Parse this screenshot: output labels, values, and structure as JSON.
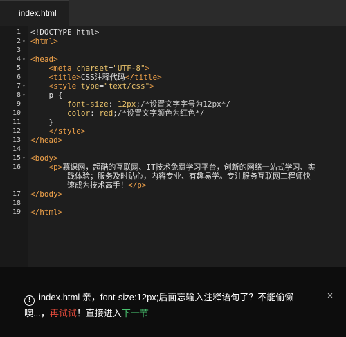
{
  "tab": {
    "filename": "index.html"
  },
  "code_lines": [
    {
      "n": "1",
      "fold": false,
      "html": "<span class=\"plain\">&lt;!DOCTYPE html&gt;</span>"
    },
    {
      "n": "2",
      "fold": true,
      "html": "<span class=\"tag\">&lt;html&gt;</span>"
    },
    {
      "n": "3",
      "fold": false,
      "html": ""
    },
    {
      "n": "4",
      "fold": true,
      "html": "<span class=\"tag\">&lt;head&gt;</span>"
    },
    {
      "n": "5",
      "fold": false,
      "html": "    <span class=\"tag\">&lt;meta</span> <span class=\"attr\">charset</span><span class=\"plain\">=</span><span class=\"str\">\"UTF-8\"</span><span class=\"tag\">&gt;</span>"
    },
    {
      "n": "6",
      "fold": false,
      "html": "    <span class=\"tag\">&lt;title&gt;</span><span class=\"plain\">CSS注释代码</span><span class=\"tag\">&lt;/title&gt;</span>"
    },
    {
      "n": "7",
      "fold": true,
      "html": "    <span class=\"tag\">&lt;style</span> <span class=\"attr\">type</span><span class=\"plain\">=</span><span class=\"str\">\"text/css\"</span><span class=\"tag\">&gt;</span>"
    },
    {
      "n": "8",
      "fold": true,
      "html": "    <span class=\"plain\">p {</span>"
    },
    {
      "n": "9",
      "fold": false,
      "html": "        <span class=\"prop\">font-size</span><span class=\"plain\">: </span><span class=\"num\">12px</span><span class=\"plain\">;</span><span class=\"cmt\">/*设置文字字号为12px*/</span>"
    },
    {
      "n": "10",
      "fold": false,
      "html": "        <span class=\"prop\">color</span><span class=\"plain\">: </span><span class=\"val\">red</span><span class=\"plain\">;</span><span class=\"cmt\">/*设置文字颜色为红色*/</span>"
    },
    {
      "n": "11",
      "fold": false,
      "html": "    <span class=\"plain\">}</span>"
    },
    {
      "n": "12",
      "fold": false,
      "html": "    <span class=\"tag\">&lt;/style&gt;</span>"
    },
    {
      "n": "13",
      "fold": false,
      "html": "<span class=\"tag\">&lt;/head&gt;</span>"
    },
    {
      "n": "14",
      "fold": false,
      "html": ""
    },
    {
      "n": "15",
      "fold": true,
      "html": "<span class=\"tag\">&lt;body&gt;</span>"
    },
    {
      "n": "16",
      "fold": false,
      "html": "    <span class=\"tag\">&lt;p&gt;</span><span class=\"plain\">慕课网，超酷的互联网、IT技术免费学习平台，创新的网络一站式学习、实</span>"
    },
    {
      "n": "",
      "fold": false,
      "html": "        <span class=\"plain\">践体验；服务及时贴心，内容专业、有趣易学。专注服务互联网工程师快</span>"
    },
    {
      "n": "",
      "fold": false,
      "html": "        <span class=\"plain\">速成为技术高手！</span><span class=\"tag\">&lt;/p&gt;</span>"
    },
    {
      "n": "17",
      "fold": false,
      "html": "<span class=\"tag\">&lt;/body&gt;</span>"
    },
    {
      "n": "18",
      "fold": false,
      "html": ""
    },
    {
      "n": "19",
      "fold": false,
      "html": "<span class=\"tag\">&lt;/html&gt;</span>"
    }
  ],
  "hint": {
    "icon": "warning-circle-icon",
    "message": "index.html 亲，font-size:12px;后面忘输入注释语句了？不能偷懒噢...，",
    "retry_label": "再试试",
    "middle_text": "！直接进入",
    "next_label": "下一节",
    "close_glyph": "×"
  },
  "colors": {
    "tag": "#f0a24a",
    "attr_value": "#e9c26b",
    "retry": "#e84b3c",
    "next": "#48c06d"
  }
}
